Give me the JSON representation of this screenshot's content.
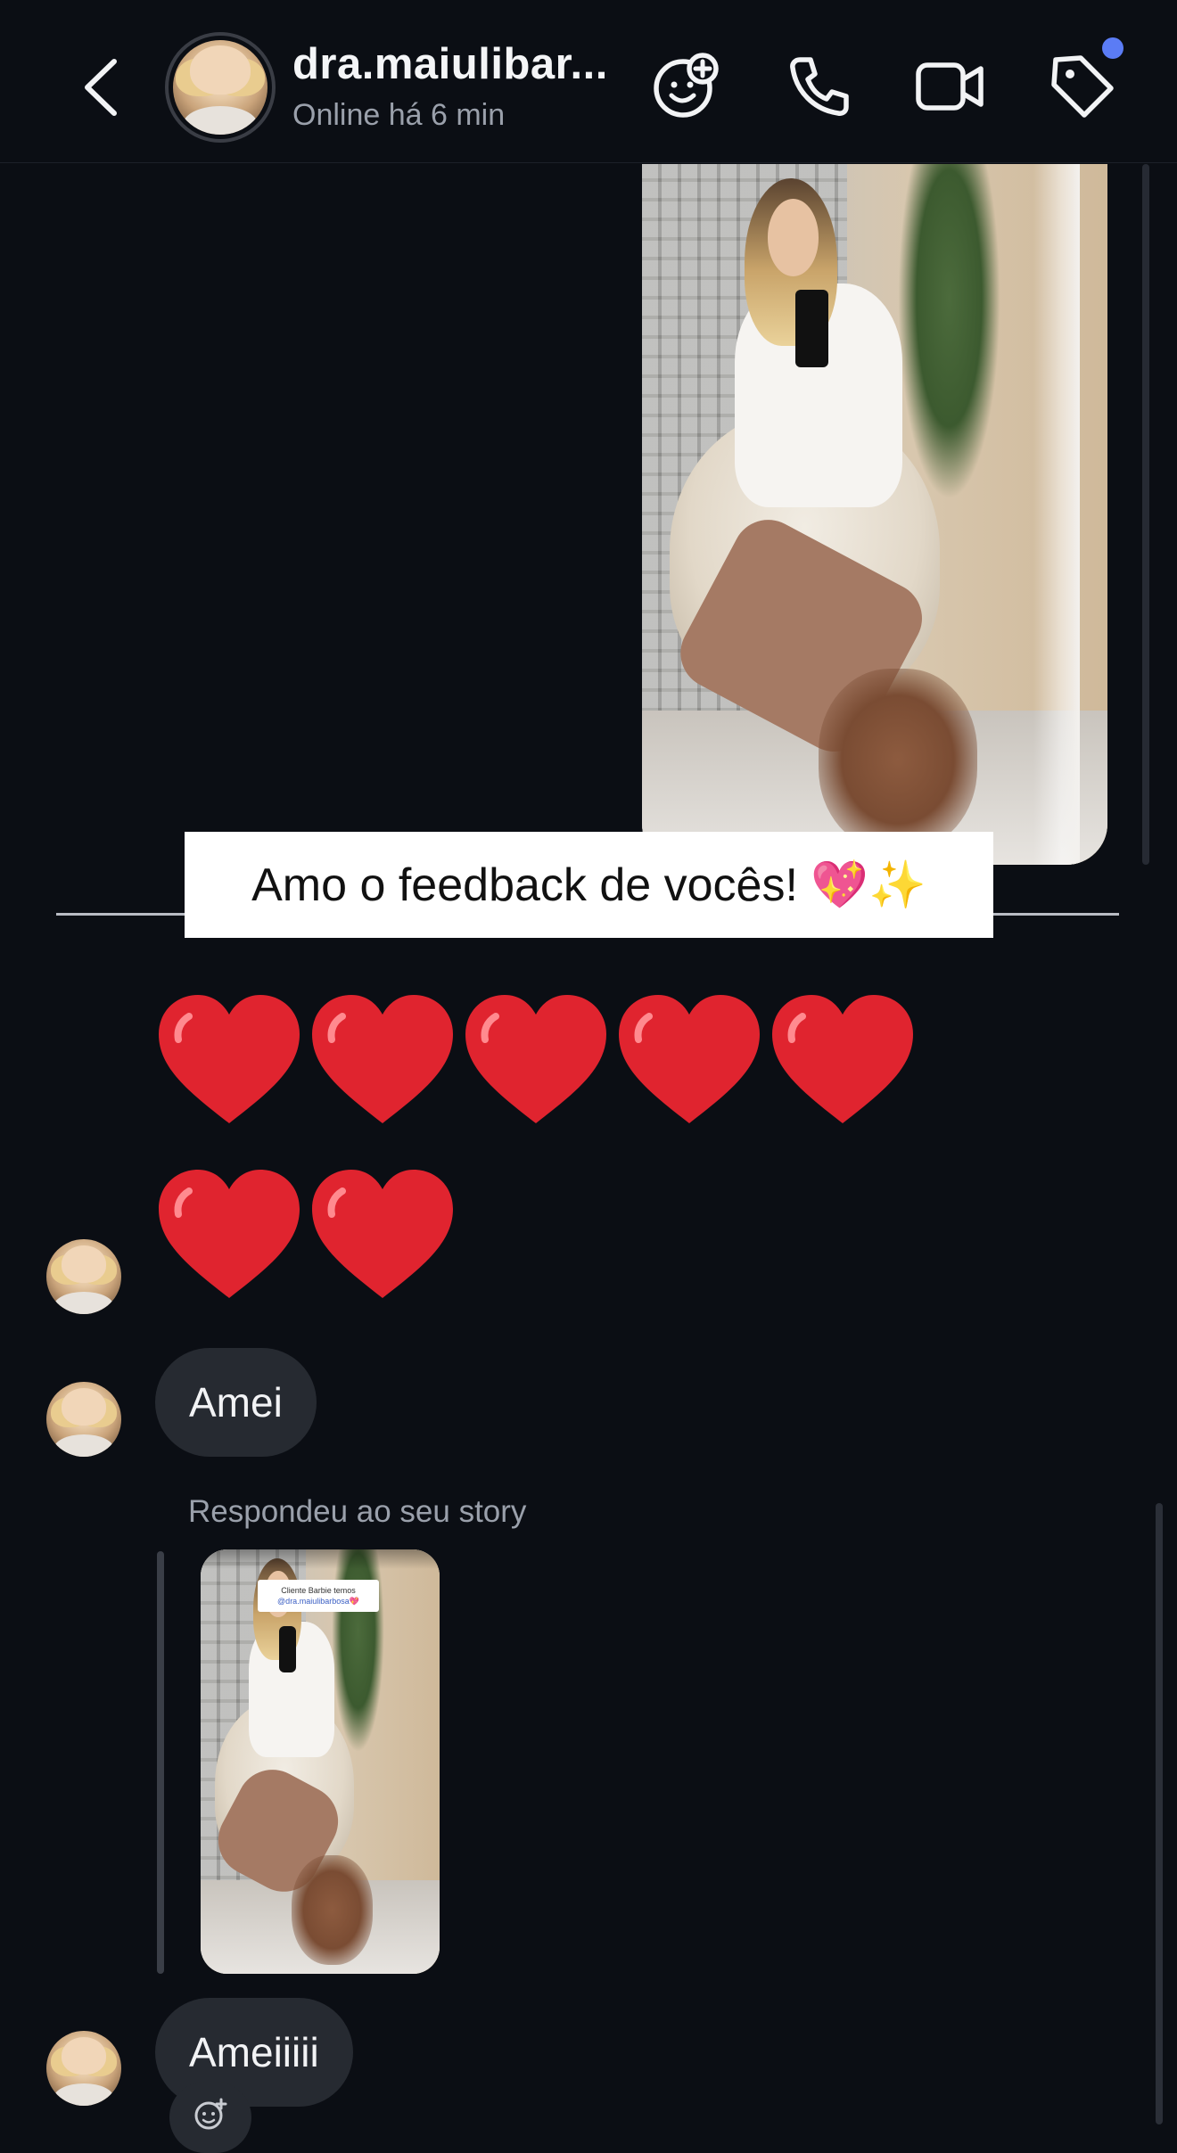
{
  "header": {
    "title": "dra.maiulibar...",
    "status": "Online há 6 min",
    "icons": {
      "back": "chevron-left-icon",
      "effects": "face-plus-icon",
      "call": "phone-icon",
      "video": "video-camera-icon",
      "tag": "tag-icon"
    },
    "notification_dot_color": "#5b7cf5"
  },
  "shared_post": {
    "caption": "Amo o feedback de vocês! 💖✨"
  },
  "messages": [
    {
      "type": "emoji",
      "content": "❤️❤️❤️❤️❤️❤️❤️",
      "heart_count": 7
    },
    {
      "type": "text",
      "content": "Amei"
    },
    {
      "type": "story_reply",
      "label": "Respondeu ao seu story",
      "story_caption_line1": "Cliente Barbie temos",
      "story_caption_line2": "@dra.maiulibarbosa💖"
    },
    {
      "type": "text",
      "content": "Ameiiiii"
    }
  ],
  "colors": {
    "background": "#0b0e14",
    "bubble": "#262a31",
    "heart": "#e0242f"
  }
}
